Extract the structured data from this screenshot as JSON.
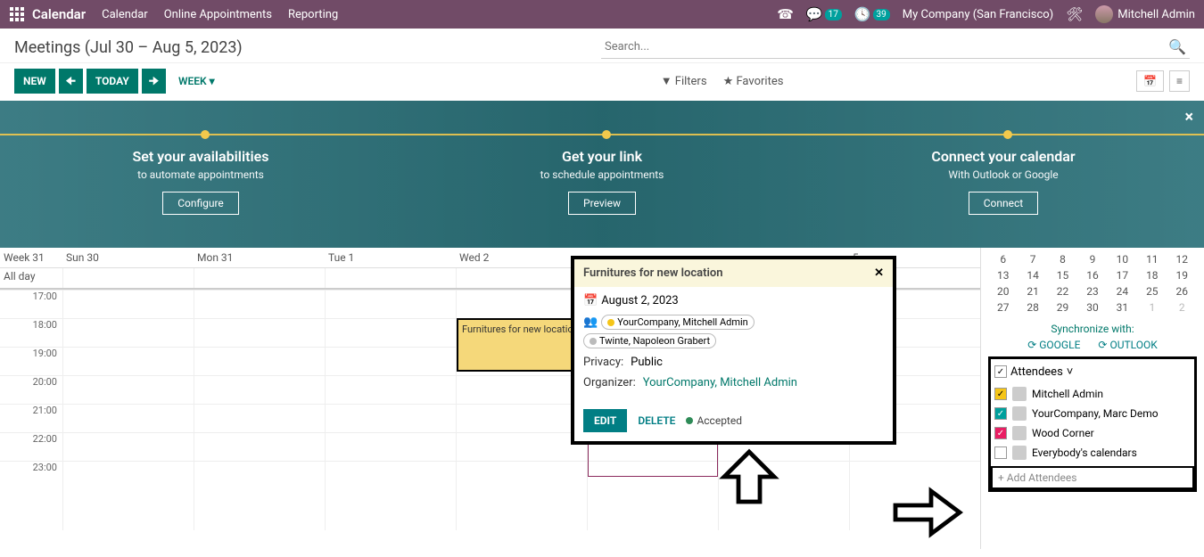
{
  "topbar": {
    "brand": "Calendar",
    "links": [
      "Calendar",
      "Online Appointments",
      "Reporting"
    ],
    "chat_badge": "17",
    "clock_badge": "39",
    "company": "My Company (San Francisco)",
    "user": "Mitchell Admin"
  },
  "header": {
    "title": "Meetings (Jul 30 – Aug 5, 2023)",
    "search_placeholder": "Search..."
  },
  "toolbar": {
    "new": "NEW",
    "today": "TODAY",
    "view": "WEEK",
    "filters": "Filters",
    "favorites": "Favorites"
  },
  "banner": {
    "cols": [
      {
        "title": "Set your availabilities",
        "sub": "to automate appointments",
        "btn": "Configure"
      },
      {
        "title": "Get your link",
        "sub": "to schedule appointments",
        "btn": "Preview"
      },
      {
        "title": "Connect your calendar",
        "sub": "With Outlook or Google",
        "btn": "Connect"
      }
    ]
  },
  "calendar": {
    "week_label": "Week 31",
    "days": [
      "Sun 30",
      "Mon 31",
      "Tue 1",
      "Wed 2",
      "",
      "",
      "5"
    ],
    "allday": "All day",
    "hours": [
      "17:00",
      "18:00",
      "19:00",
      "20:00",
      "21:00",
      "22:00",
      "23:00"
    ],
    "event": "Furnitures for new location"
  },
  "popover": {
    "title": "Furnitures for new location",
    "date": "August 2, 2023",
    "att1": "YourCompany, Mitchell Admin",
    "att2": "Twinte, Napoleon Grabert",
    "privacy_lbl": "Privacy:",
    "privacy_val": "Public",
    "org_lbl": "Organizer:",
    "org_val": "YourCompany, Mitchell Admin",
    "edit": "EDIT",
    "delete": "DELETE",
    "accepted": "Accepted"
  },
  "mini": {
    "rows": [
      [
        "6",
        "7",
        "8",
        "9",
        "10",
        "11",
        "12"
      ],
      [
        "13",
        "14",
        "15",
        "16",
        "17",
        "18",
        "19"
      ],
      [
        "20",
        "21",
        "22",
        "23",
        "24",
        "25",
        "26"
      ],
      [
        "27",
        "28",
        "29",
        "30",
        "31",
        "1",
        "2"
      ]
    ],
    "dim_last": 2,
    "sync_label": "Synchronize with:",
    "google": "GOOGLE",
    "outlook": "OUTLOOK"
  },
  "attendees": {
    "header": "Attendees",
    "rows": [
      {
        "chk": "yellow",
        "name": "Mitchell Admin"
      },
      {
        "chk": "teal",
        "name": "YourCompany, Marc Demo"
      },
      {
        "chk": "pink",
        "name": "Wood Corner"
      },
      {
        "chk": "",
        "name": "Everybody's calendars"
      }
    ],
    "add": "+ Add Attendees"
  }
}
